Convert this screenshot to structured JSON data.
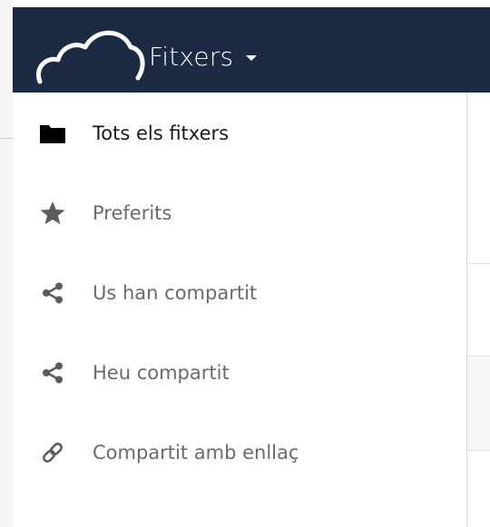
{
  "header": {
    "app_name": "Fitxers",
    "background_color": "#1d2a43",
    "logo_icon": "cloud-logo-icon",
    "dropdown_icon": "caret-down-icon"
  },
  "menu": {
    "items": [
      {
        "label": "Tots els fitxers",
        "icon": "folder-icon",
        "active": true
      },
      {
        "label": "Preferits",
        "icon": "star-icon",
        "active": false
      },
      {
        "label": "Us han compartit",
        "icon": "share-icon",
        "active": false
      },
      {
        "label": "Heu compartit",
        "icon": "share-icon",
        "active": false
      },
      {
        "label": "Compartit amb enllaç",
        "icon": "link-icon",
        "active": false
      }
    ],
    "active_text_color": "#1a1a1a",
    "inactive_text_color": "#6a6a6a"
  }
}
